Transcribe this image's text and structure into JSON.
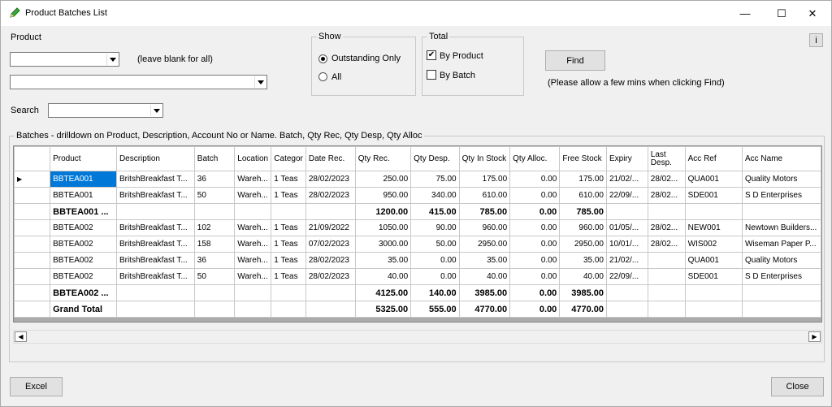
{
  "window": {
    "title": "Product Batches List",
    "icon": "pencil-icon",
    "controls": [
      "—",
      "☐",
      "✕"
    ]
  },
  "product_label": "Product",
  "leave_blank": "(leave blank for all)",
  "search_label": "Search",
  "show": {
    "title": "Show",
    "options": [
      "Outstanding Only",
      "All"
    ],
    "selected": "Outstanding Only"
  },
  "total": {
    "title": "Total",
    "by_product": "By Product",
    "by_batch": "By Batch",
    "by_product_checked": true,
    "by_batch_checked": false
  },
  "find": {
    "label": "Find",
    "note": "(Please allow a few mins when clicking Find)"
  },
  "info_button": "i",
  "batches": {
    "title": "Batches - drilldown on Product, Description, Account No or Name. Batch, Qty Rec, Qty Desp, Qty Alloc",
    "headers": [
      "Product",
      "Description",
      "Batch",
      "Location",
      "Categor",
      "Date Rec.",
      "Qty Rec.",
      "Qty Desp.",
      "Qty In Stock",
      "Qty Alloc.",
      "Free Stock",
      "Expiry",
      "Last Desp.",
      "Acc Ref",
      "Acc Name"
    ],
    "rows": [
      [
        "BBTEA001",
        "BritshBreakfast  T...",
        "36",
        "Wareh...",
        "1 Teas",
        "28/02/2023",
        "250.00",
        "75.00",
        "175.00",
        "0.00",
        "175.00",
        "21/02/...",
        "28/02...",
        "QUA001",
        "Quality Motors"
      ],
      [
        "BBTEA001",
        "BritshBreakfast  T...",
        "50",
        "Wareh...",
        "1 Teas",
        "28/02/2023",
        "950.00",
        "340.00",
        "610.00",
        "0.00",
        "610.00",
        "22/09/...",
        "28/02...",
        "SDE001",
        "S D Enterprises"
      ],
      [
        "BBTEA001 ...",
        "",
        "",
        "",
        "",
        "",
        "1200.00",
        "415.00",
        "785.00",
        "0.00",
        "785.00",
        "",
        "",
        "",
        ""
      ],
      [
        "BBTEA002",
        "BritshBreakfast  T...",
        "102",
        "Wareh...",
        "1 Teas",
        "21/09/2022",
        "1050.00",
        "90.00",
        "960.00",
        "0.00",
        "960.00",
        "01/05/...",
        "28/02...",
        "NEW001",
        "Newtown Builders..."
      ],
      [
        "BBTEA002",
        "BritshBreakfast  T...",
        "158",
        "Wareh...",
        "1 Teas",
        "07/02/2023",
        "3000.00",
        "50.00",
        "2950.00",
        "0.00",
        "2950.00",
        "10/01/...",
        "28/02...",
        "WIS002",
        "Wiseman Paper P..."
      ],
      [
        "BBTEA002",
        "BritshBreakfast  T...",
        "36",
        "Wareh...",
        "1 Teas",
        "28/02/2023",
        "35.00",
        "0.00",
        "35.00",
        "0.00",
        "35.00",
        "21/02/...",
        "",
        "QUA001",
        "Quality Motors"
      ],
      [
        "BBTEA002",
        "BritshBreakfast  T...",
        "50",
        "Wareh...",
        "1 Teas",
        "28/02/2023",
        "40.00",
        "0.00",
        "40.00",
        "0.00",
        "40.00",
        "22/09/...",
        "",
        "SDE001",
        "S D Enterprises"
      ],
      [
        "BBTEA002 ...",
        "",
        "",
        "",
        "",
        "",
        "4125.00",
        "140.00",
        "3985.00",
        "0.00",
        "3985.00",
        "",
        "",
        "",
        ""
      ],
      [
        "Grand Total",
        "",
        "",
        "",
        "",
        "",
        "5325.00",
        "555.00",
        "4770.00",
        "0.00",
        "4770.00",
        "",
        "",
        "",
        ""
      ]
    ],
    "total_rows": [
      2,
      7,
      8
    ],
    "current_row_marker": "▶"
  },
  "buttons": {
    "excel": "Excel",
    "close": "Close"
  },
  "colors": {
    "selection": "#0078d7",
    "window_bg": "#f0f0f0"
  }
}
